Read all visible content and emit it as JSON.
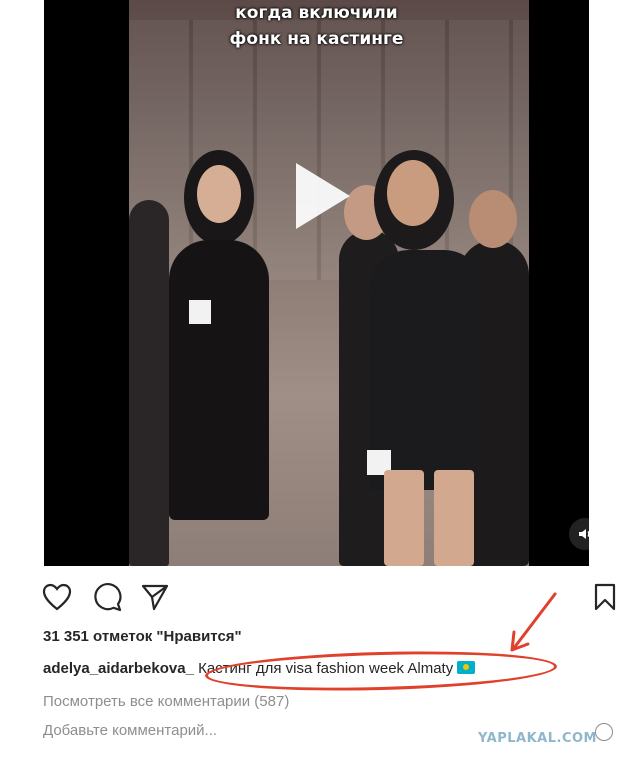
{
  "video": {
    "overlay_lines": [
      "когда включили",
      "фонк на кастинге"
    ],
    "play_icon": "play-icon",
    "sound_icon": "speaker-icon"
  },
  "actions": {
    "like_icon": "heart-icon",
    "comment_icon": "comment-icon",
    "share_icon": "send-icon",
    "save_icon": "bookmark-icon"
  },
  "likes_text": "31 351 отметок \"Нравится\"",
  "caption": {
    "username": "adelya_aidarbekova_",
    "text": " Кастинг для visa fashion week Almaty"
  },
  "comments": {
    "view_all": "Посмотреть все комментарии (587)",
    "placeholder": "Добавьте комментарий..."
  },
  "watermark": "YAPLAKAL.COM",
  "colors": {
    "annotation_red": "#e0412c",
    "muted_text": "#8e8e8e"
  }
}
